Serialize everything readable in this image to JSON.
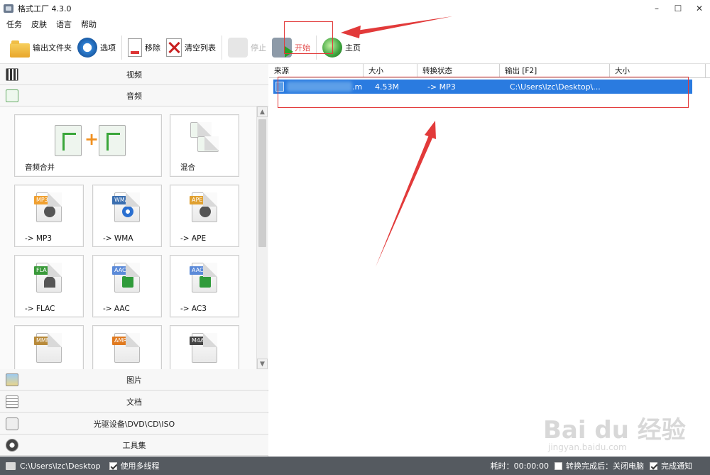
{
  "window": {
    "title": "格式工厂 4.3.0",
    "minimize": "–",
    "maximize": "☐",
    "close": "✕"
  },
  "menu": [
    "任务",
    "皮肤",
    "语言",
    "帮助"
  ],
  "toolbar": {
    "output_folder": "输出文件夹",
    "options": "选项",
    "remove": "移除",
    "clear_list": "清空列表",
    "stop": "停止",
    "start": "开始",
    "home": "主页"
  },
  "categories": {
    "video": "视频",
    "audio": "音频",
    "picture": "图片",
    "document": "文档",
    "optical": "光驱设备\\DVD\\CD\\ISO",
    "tools": "工具集"
  },
  "tiles": {
    "audio_merge": "音频合并",
    "mix": "混合",
    "mp3": "-> MP3",
    "wma": "-> WMA",
    "ape": "-> APE",
    "flac": "-> FLAC",
    "aac": "-> AAC",
    "ac3": "-> AC3",
    "badges": {
      "mp3": "MP3",
      "wma": "WMA",
      "ape": "APE",
      "fla": "FLA",
      "aac": "AAC",
      "ac3": "AAC",
      "mmf": "MMF",
      "amr": "AMR",
      "m4a": "M4A"
    }
  },
  "table": {
    "headers": [
      "来源",
      "大小",
      "转换状态",
      "输出 [F2]",
      "大小"
    ],
    "row": {
      "source_suffix": ".m",
      "size": "4.53M",
      "status": "-> MP3",
      "output": "C:\\Users\\lzc\\Desktop\\..."
    }
  },
  "status": {
    "folder": "C:\\Users\\lzc\\Desktop",
    "multithread": "使用多线程",
    "elapsed": "耗时：00:00:00",
    "after_convert": "转换完成后：关闭电脑",
    "notify": "完成通知"
  },
  "watermark": {
    "brand": "Bai du 经验",
    "url": "jingyan.baidu.com"
  },
  "colors": {
    "selection": "#2a7be0",
    "statusbar": "#555a60",
    "annotation": "#e23a3a"
  }
}
